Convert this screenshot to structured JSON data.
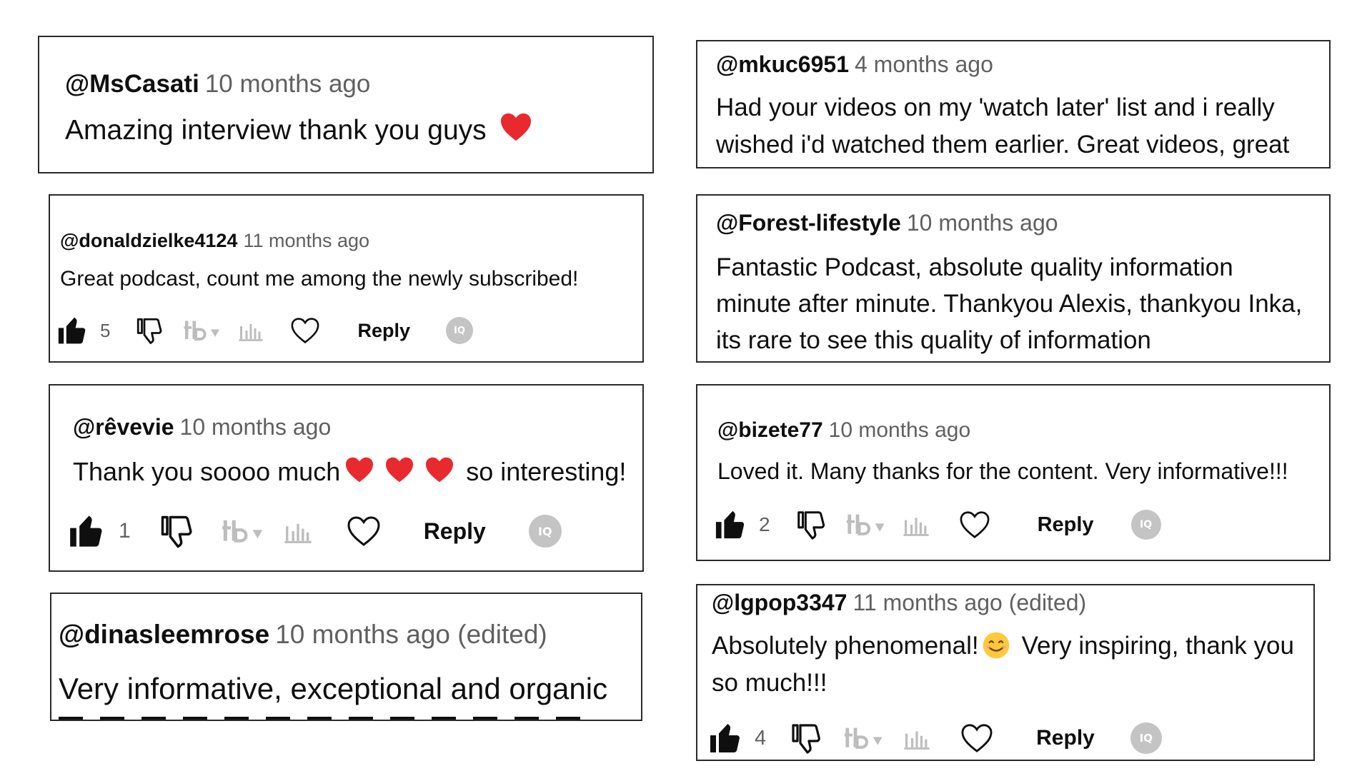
{
  "colors": {
    "heart": "#e8292e",
    "muted": "#606060",
    "border": "#2a2a2a",
    "iq_badge": "#c4c4c4"
  },
  "comments": [
    {
      "handle": "@MsCasati",
      "meta": "10 months ago",
      "text": "Amazing interview thank you guys",
      "emoji": "heart"
    },
    {
      "handle": "@mkuc6951",
      "meta": "4 months ago",
      "line1": "Had your videos on my 'watch later' list and i really",
      "line2": "wished i'd watched them earlier. Great videos, great"
    },
    {
      "handle": "@donaldzielke4124",
      "meta": "11 months ago",
      "text": "Great podcast, count me among the newly subscribed!",
      "likes": "5",
      "reply": "Reply",
      "iq": "IQ"
    },
    {
      "handle": "@Forest-lifestyle",
      "meta": "10 months ago",
      "line1": "Fantastic Podcast, absolute quality information",
      "line2": "minute after minute. Thankyou Alexis, thankyou Inka,",
      "line3": "its rare to see this quality of information"
    },
    {
      "handle": "@rêvevie",
      "meta": "10 months ago",
      "text_a": "Thank you soooo much",
      "text_b": "so interesting!",
      "likes": "1",
      "reply": "Reply",
      "iq": "IQ"
    },
    {
      "handle": "@bizete77",
      "meta": "10 months ago",
      "text": "Loved it. Many thanks for the content. Very informative!!!",
      "likes": "2",
      "reply": "Reply",
      "iq": "IQ"
    },
    {
      "handle": "@dinasleemrose",
      "meta": "10 months ago (edited)",
      "text": "Very informative, exceptional and organic"
    },
    {
      "handle": "@lgpop3347",
      "meta": "11 months ago (edited)",
      "text_a": "Absolutely phenomenal!",
      "text_b": "Very inspiring, thank you",
      "line2": "so much!!!",
      "likes": "4",
      "reply": "Reply",
      "iq": "IQ"
    }
  ]
}
